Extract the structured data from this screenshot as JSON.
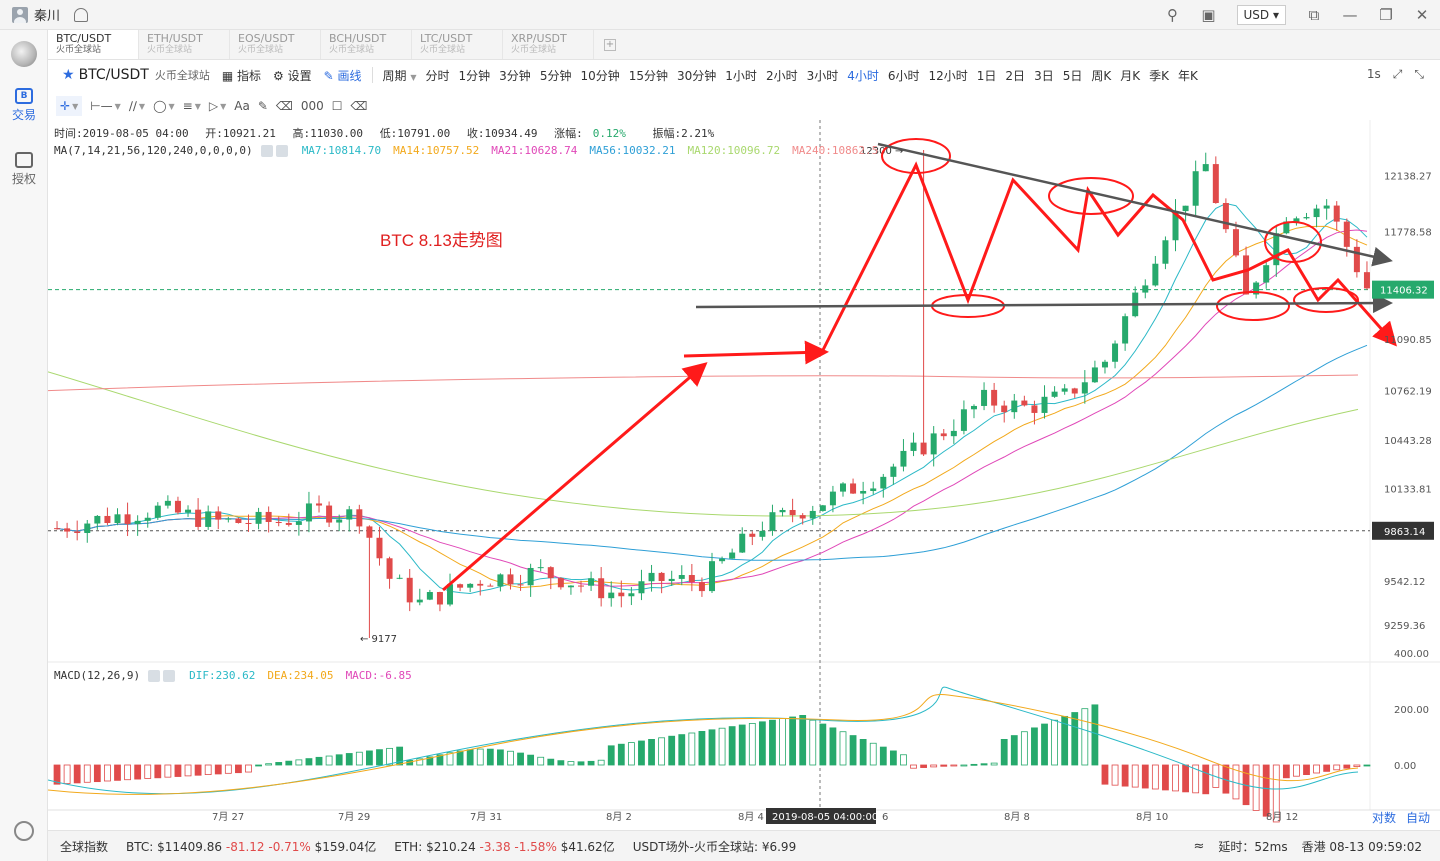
{
  "titlebar": {
    "username": "秦川",
    "currency": "USD",
    "icons": [
      "search-icon",
      "shirt-icon",
      "window-icon",
      "minimize-icon",
      "restore-icon",
      "close-icon"
    ]
  },
  "sidebar": {
    "items": [
      {
        "label": "交易",
        "icon": "B",
        "active": true
      },
      {
        "label": "授权",
        "icon": "key-icon",
        "active": false
      }
    ]
  },
  "tabs": [
    {
      "symbol": "BTC/USDT",
      "exchange": "火币全球站",
      "active": true
    },
    {
      "symbol": "ETH/USDT",
      "exchange": "火币全球站",
      "active": false
    },
    {
      "symbol": "EOS/USDT",
      "exchange": "火币全球站",
      "active": false
    },
    {
      "symbol": "BCH/USDT",
      "exchange": "火币全球站",
      "active": false
    },
    {
      "symbol": "LTC/USDT",
      "exchange": "火币全球站",
      "active": false
    },
    {
      "symbol": "XRP/USDT",
      "exchange": "火币全球站",
      "active": false
    }
  ],
  "toolbar": {
    "pair": "BTC/USDT",
    "exchange": "火币全球站",
    "indicator": "指标",
    "settings": "设置",
    "draw": "画线",
    "period_label": "周期",
    "periods": [
      "分时",
      "1分钟",
      "3分钟",
      "5分钟",
      "10分钟",
      "15分钟",
      "30分钟",
      "1小时",
      "2小时",
      "3小时",
      "4小时",
      "6小时",
      "12小时",
      "1日",
      "2日",
      "3日",
      "5日",
      "周K",
      "月K",
      "季K",
      "年K"
    ],
    "active_period": "4小时",
    "interval": "1s"
  },
  "draw_tools": [
    "crosshair",
    "h-line",
    "trend-line",
    "circle",
    "ruler",
    "arrow",
    "Aa",
    "pen",
    "eraser",
    "000",
    "lock",
    "trash"
  ],
  "info": {
    "time": "时间:2019-08-05 04:00",
    "open": "开:10921.21",
    "high": "高:11030.00",
    "low": "低:10791.00",
    "close": "收:10934.49",
    "change_label": "涨幅:",
    "change": "0.12%",
    "amplitude": "振幅:2.21%"
  },
  "ma": {
    "label": "MA(7,14,21,56,120,240,0,0,0,0)",
    "values": [
      {
        "text": "MA7:10814.70",
        "color": "#2bb9c7"
      },
      {
        "text": "MA14:10757.52",
        "color": "#f2a91c"
      },
      {
        "text": "MA21:10628.74",
        "color": "#e048b8"
      },
      {
        "text": "MA56:10032.21",
        "color": "#2e9fd6"
      },
      {
        "text": "MA120:10096.72",
        "color": "#a9d86e"
      },
      {
        "text": "MA240:10862.5",
        "color": "#f08a8a"
      }
    ]
  },
  "macd": {
    "label": "MACD(12,26,9)",
    "values": [
      {
        "text": "DIF:230.62",
        "color": "#2bb9c7"
      },
      {
        "text": "DEA:234.05",
        "color": "#f2a91c"
      },
      {
        "text": "MACD:-6.85",
        "color": "#e048b8"
      }
    ],
    "axis": [
      "400.00",
      "200.00",
      "0.00"
    ]
  },
  "price_axis": [
    "12138.27",
    "11778.58",
    "11090.85",
    "10762.19",
    "10443.28",
    "10133.81",
    "9542.12",
    "9259.36"
  ],
  "current_price": "11406.32",
  "hover_price": "9863.14",
  "high_label": "12300",
  "low_label": "9177",
  "date_axis": [
    "7月 27",
    "7月 29",
    "7月 31",
    "8月 2",
    "8月 4",
    "6",
    "8月 8",
    "8月 10",
    "8月 12"
  ],
  "crosshair_time": "2019-08-05 04:00:00",
  "annotation": "BTC 8.13走势图",
  "corner": {
    "log": "对数",
    "auto": "自动"
  },
  "statusbar": {
    "index": "全球指数",
    "btc_label": "BTC:",
    "btc_price": "$11409.86",
    "btc_change": "-81.12 -0.71%",
    "btc_volume": "$159.04亿",
    "eth_label": "ETH:",
    "eth_price": "$210.24",
    "eth_change": "-3.38 -1.58%",
    "eth_volume": "$41.62亿",
    "usdt": "USDT场外-火币全球站: ¥6.99",
    "latency": "延时：52ms",
    "location": "香港 08-13 09:59:02"
  },
  "colors": {
    "up": "#26a96c",
    "down": "#e04a4a",
    "accent": "#2d6cdf",
    "annotation": "#ff1a1a"
  }
}
